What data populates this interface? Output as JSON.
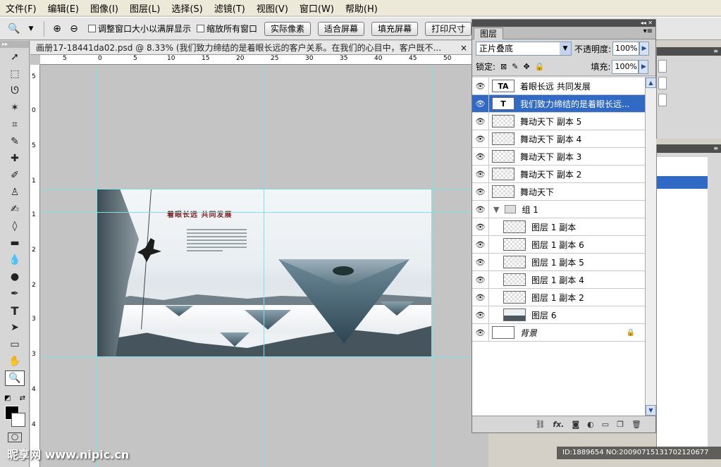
{
  "menu": [
    "文件(F)",
    "编辑(E)",
    "图像(I)",
    "图层(L)",
    "选择(S)",
    "滤镜(T)",
    "视图(V)",
    "窗口(W)",
    "帮助(H)"
  ],
  "options": {
    "resize_window": "调整窗口大小以满屏显示",
    "zoom_all": "缩放所有窗口",
    "actual_pixels": "实际像素",
    "fit_screen": "适合屏幕",
    "fill_screen": "填充屏幕",
    "print_size": "打印尺寸"
  },
  "document": {
    "title": "画册17-18441da02.psd @ 8.33% (我们致力缔结的是着眼长远的客户关系。在我们的心目中，客户既不...",
    "close": "×"
  },
  "rulers": {
    "h_labels": [
      "5",
      "0",
      "5",
      "10",
      "15",
      "20",
      "25",
      "30",
      "35",
      "40",
      "45",
      "50"
    ],
    "v_labels": [
      "5",
      "0",
      "5",
      "1",
      "1",
      "2",
      "2",
      "3",
      "3",
      "4",
      "4"
    ]
  },
  "artwork": {
    "title": "着眼长远  共同发展"
  },
  "layers_panel": {
    "tab": "图层",
    "blend_mode": "正片叠底",
    "opacity_label": "不透明度:",
    "opacity_value": "100%",
    "lock_label": "锁定:",
    "fill_label": "填充:",
    "fill_value": "100%",
    "layers": [
      {
        "name": "着眼长远 共同发展",
        "thumb": "TA",
        "kind": "text"
      },
      {
        "name": "我们致力缔结的是着眼长远...",
        "thumb": "T",
        "kind": "text",
        "selected": true
      },
      {
        "name": "舞动天下 副本 5",
        "thumb": "",
        "kind": "pixel"
      },
      {
        "name": "舞动天下 副本 4",
        "thumb": "",
        "kind": "pixel"
      },
      {
        "name": "舞动天下 副本 3",
        "thumb": "",
        "kind": "pixel"
      },
      {
        "name": "舞动天下 副本 2",
        "thumb": "",
        "kind": "pixel"
      },
      {
        "name": "舞动天下",
        "thumb": "",
        "kind": "pixel"
      },
      {
        "name": "组 1",
        "thumb": "",
        "kind": "group"
      },
      {
        "name": "图层 1 副本",
        "thumb": "",
        "kind": "pixel",
        "indented": true
      },
      {
        "name": "图层 1 副本 6",
        "thumb": "",
        "kind": "pixel",
        "indented": true
      },
      {
        "name": "图层 1 副本 5",
        "thumb": "",
        "kind": "pixel",
        "indented": true
      },
      {
        "name": "图层 1 副本 4",
        "thumb": "",
        "kind": "pixel",
        "indented": true
      },
      {
        "name": "图层 1 副本 2",
        "thumb": "",
        "kind": "pixel",
        "indented": true
      },
      {
        "name": "图层 6",
        "thumb": "",
        "kind": "photo",
        "indented": true
      },
      {
        "name": "背景",
        "thumb": "",
        "kind": "background",
        "locked": true
      }
    ],
    "bottom_icons": [
      "link-icon",
      "fx-icon",
      "mask-icon",
      "adjustment-icon",
      "group-icon",
      "new-layer-icon",
      "trash-icon"
    ],
    "fx_label": "fx."
  },
  "watermark": {
    "left": "昵享网 www.nipic.cn",
    "right": "ID:1889654 NO:20090715131702120677"
  }
}
